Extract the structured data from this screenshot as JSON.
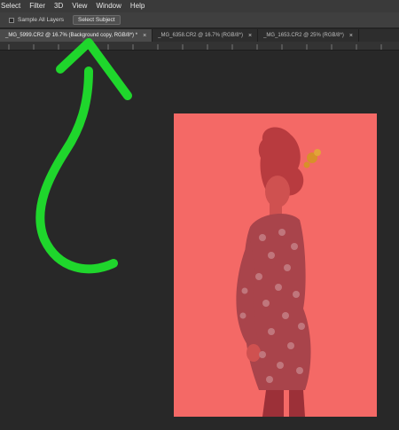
{
  "menu": {
    "items": [
      "Select",
      "Filter",
      "3D",
      "View",
      "Window",
      "Help"
    ]
  },
  "options": {
    "sample_all_layers_label": "Sample All Layers",
    "select_subject_label": "Select Subject"
  },
  "tabs": [
    {
      "label": "_MG_5999.CR2 @ 16.7% (Background copy, RGB/8*) *",
      "active": true
    },
    {
      "label": "_MG_6358.CR2 @ 16.7% (RGB/8*)",
      "active": false
    },
    {
      "label": "_MG_1653.CR2 @ 25% (RGB/8*)",
      "active": false
    }
  ],
  "tab_close_glyph": "×",
  "colors": {
    "app_bg": "#262626",
    "active_tab": "#4a4a4a",
    "quick_mask_overlay": "#f46966",
    "annotation_arrow": "#1fd62c"
  },
  "icons": {
    "arrow": "curved-up-arrow-annotation-icon"
  }
}
